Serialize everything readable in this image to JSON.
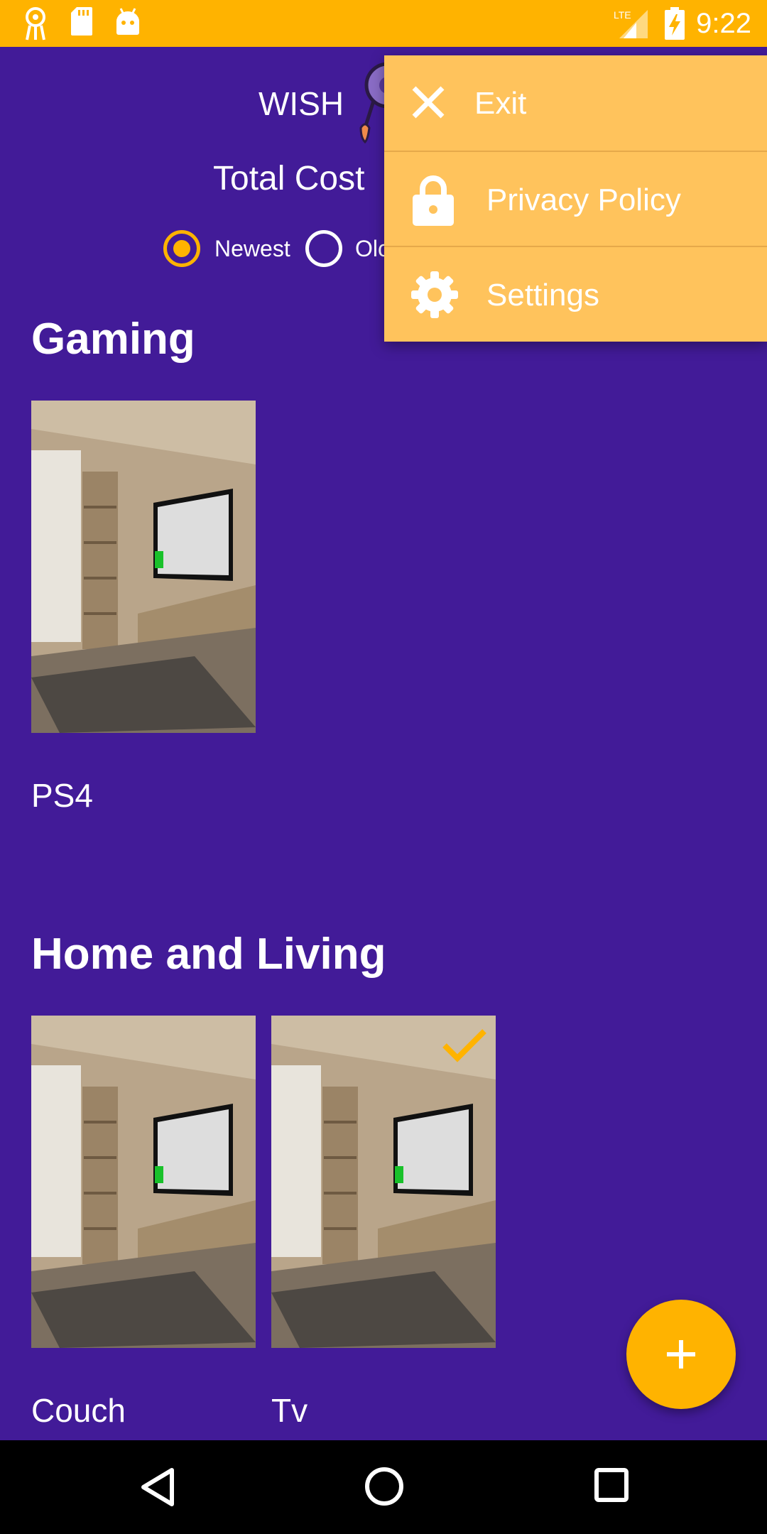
{
  "status_bar": {
    "time": "9:22",
    "network": "LTE",
    "icons": [
      "dreamcatcher-icon",
      "sd-card-icon",
      "android-icon",
      "signal-icon",
      "battery-charging-icon"
    ]
  },
  "header": {
    "title": "WISH",
    "total_cost_label": "Total Cost"
  },
  "sort": {
    "options": [
      {
        "label": "Newest",
        "selected": true
      },
      {
        "label": "Olc",
        "selected": false
      }
    ]
  },
  "sections": [
    {
      "title": "Gaming",
      "items": [
        {
          "name": "PS4",
          "checked": false
        }
      ]
    },
    {
      "title": "Home and Living",
      "items": [
        {
          "name": "Couch",
          "checked": false
        },
        {
          "name": "Tv",
          "checked": true
        }
      ]
    }
  ],
  "menu": {
    "items": [
      {
        "label": "Exit",
        "icon": "close-icon"
      },
      {
        "label": "Privacy Policy",
        "icon": "lock-icon"
      },
      {
        "label": "Settings",
        "icon": "gear-icon"
      }
    ]
  },
  "fab": {
    "icon": "plus-icon"
  },
  "nav": {
    "icons": [
      "back-icon",
      "home-icon",
      "recents-icon"
    ]
  },
  "colors": {
    "primary": "#421b98",
    "accent": "#ffb300",
    "menu_bg": "#ffc35c"
  }
}
